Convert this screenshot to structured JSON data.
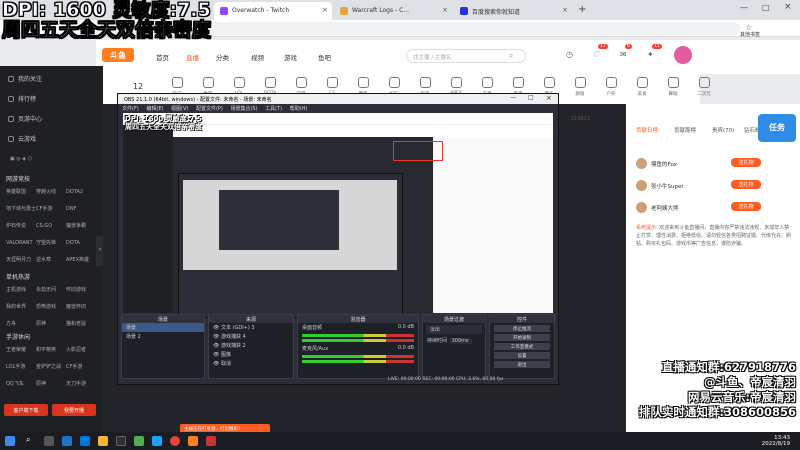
{
  "overlay": {
    "line1": "DPI: 1600 灵敏度:7.5",
    "line2": "周四五天全天双倍亲密度",
    "br1": "直播通知群:627918776",
    "br2": "@斗鱼、帝宸清羽",
    "br3": "网易云音乐:帝宸清羽",
    "br4": "排队实时通知群:308600856"
  },
  "browser": {
    "tabs": [
      "Overwatch - Twitch",
      "Warcraft Logs - C...",
      "百度搜索你就知道"
    ],
    "bookmarks_label": "其他书签",
    "url_placeholder": ""
  },
  "site": {
    "logo": "斗鱼",
    "nav": [
      "首页",
      "直播",
      "分类",
      "视频",
      "游戏",
      "鱼吧"
    ],
    "search_placeholder": "找主播 / 主播名",
    "user_badges": [
      "11",
      "6",
      "11"
    ]
  },
  "left_nav": {
    "top_items": [
      "我的关注",
      "排行榜",
      "页游中心",
      "云游戏"
    ],
    "sec1_title": "网游竞技",
    "sec1": [
      "英雄联盟",
      "穿越火线",
      "DOTA2",
      "地下城与勇士",
      "CF手游",
      "DNF",
      "炉石传说",
      "CS:GO",
      "魔兽争霸",
      "VALORANT",
      "守望先锋",
      "DOTA",
      "天涯明月刀",
      "逆水寒",
      "APEX英雄"
    ],
    "sec2_title": "单机热游",
    "sec2": [
      "主机游戏",
      "永劫无间",
      "怀旧游戏",
      "我的世界",
      "恐怖游戏",
      "魔兽怀旧",
      "方舟",
      "原神",
      "猫和老鼠"
    ],
    "sec3_title": "手游休闲",
    "sec3": [
      "王者荣耀",
      "和平精英",
      "火影忍者",
      "LOL手游",
      "金铲铲之战",
      "CF手游",
      "QQ飞车",
      "原神",
      "天刀手游"
    ],
    "btn_download": "客户端下载",
    "btn_open": "我要开播"
  },
  "cat_row": {
    "count": "12",
    "items": [
      "热门",
      "推荐",
      "LOL",
      "DOTA",
      "守望",
      "CS",
      "魔兽",
      "炉石",
      "吃鸡",
      "APEX",
      "王者",
      "原神",
      "音乐",
      "颜值",
      "户外",
      "美食",
      "舞蹈",
      "二次元"
    ]
  },
  "obs": {
    "title": "OBS 21.1.0 (64bit, windows) - 配置文件: 未命名 - 场景: 未命名",
    "menu": [
      "文件(F)",
      "编辑(E)",
      "视图(V)",
      "配置文件(P)",
      "场景集合(S)",
      "工具(T)",
      "帮助(H)"
    ],
    "scenes_title": "场景",
    "scenes": [
      "场景",
      "场景 2"
    ],
    "sources_title": "来源",
    "sources": [
      "文本 (GDI+) 3",
      "游戏捕获 4",
      "游戏捕获 2",
      "图像",
      "取消"
    ],
    "mixer_title": "混音器",
    "mixer": [
      "桌面音频",
      "麦克风/Aux"
    ],
    "mixer_db": [
      "0.0 dB",
      "0.0 dB"
    ],
    "transition_title": "场景过渡",
    "transition_value": "淡出",
    "transition_duration_label": "持续时间",
    "transition_duration": "300ms",
    "controls_title": "控件",
    "controls": [
      "停止推流",
      "开始录制",
      "工作室模式",
      "设置",
      "退出"
    ],
    "status": "LIVE: 00:00:00   REC: 00:00:00   CPU: 3.6%, 60.00 fps"
  },
  "right_panel": {
    "room_id": "219913",
    "tabs": [
      "贡献日榜",
      "贡献周榜",
      "贵宾(70)",
      "钻石粉丝"
    ],
    "ranks": [
      {
        "name": "摸鱼的Fox"
      },
      {
        "name": "张小牛Super"
      },
      {
        "name": "老阿姨大熊"
      }
    ],
    "rank_btn": "送礼物",
    "notice_title": "系统提示:",
    "notice": "欢迎来到斗鱼直播间，直播内容严禁违法违规、未成年人禁止打赏、理性消费、拒绝低俗。请勿轻信各类招聘征婚、代练代充、刷钻、购买礼包码、游戏币等广告信息，谨防诈骗。"
  },
  "bottom_popup": "主播正在打星战…打出精彩！",
  "taskbar": {
    "time": "13:43",
    "date": "2022/8/19"
  }
}
